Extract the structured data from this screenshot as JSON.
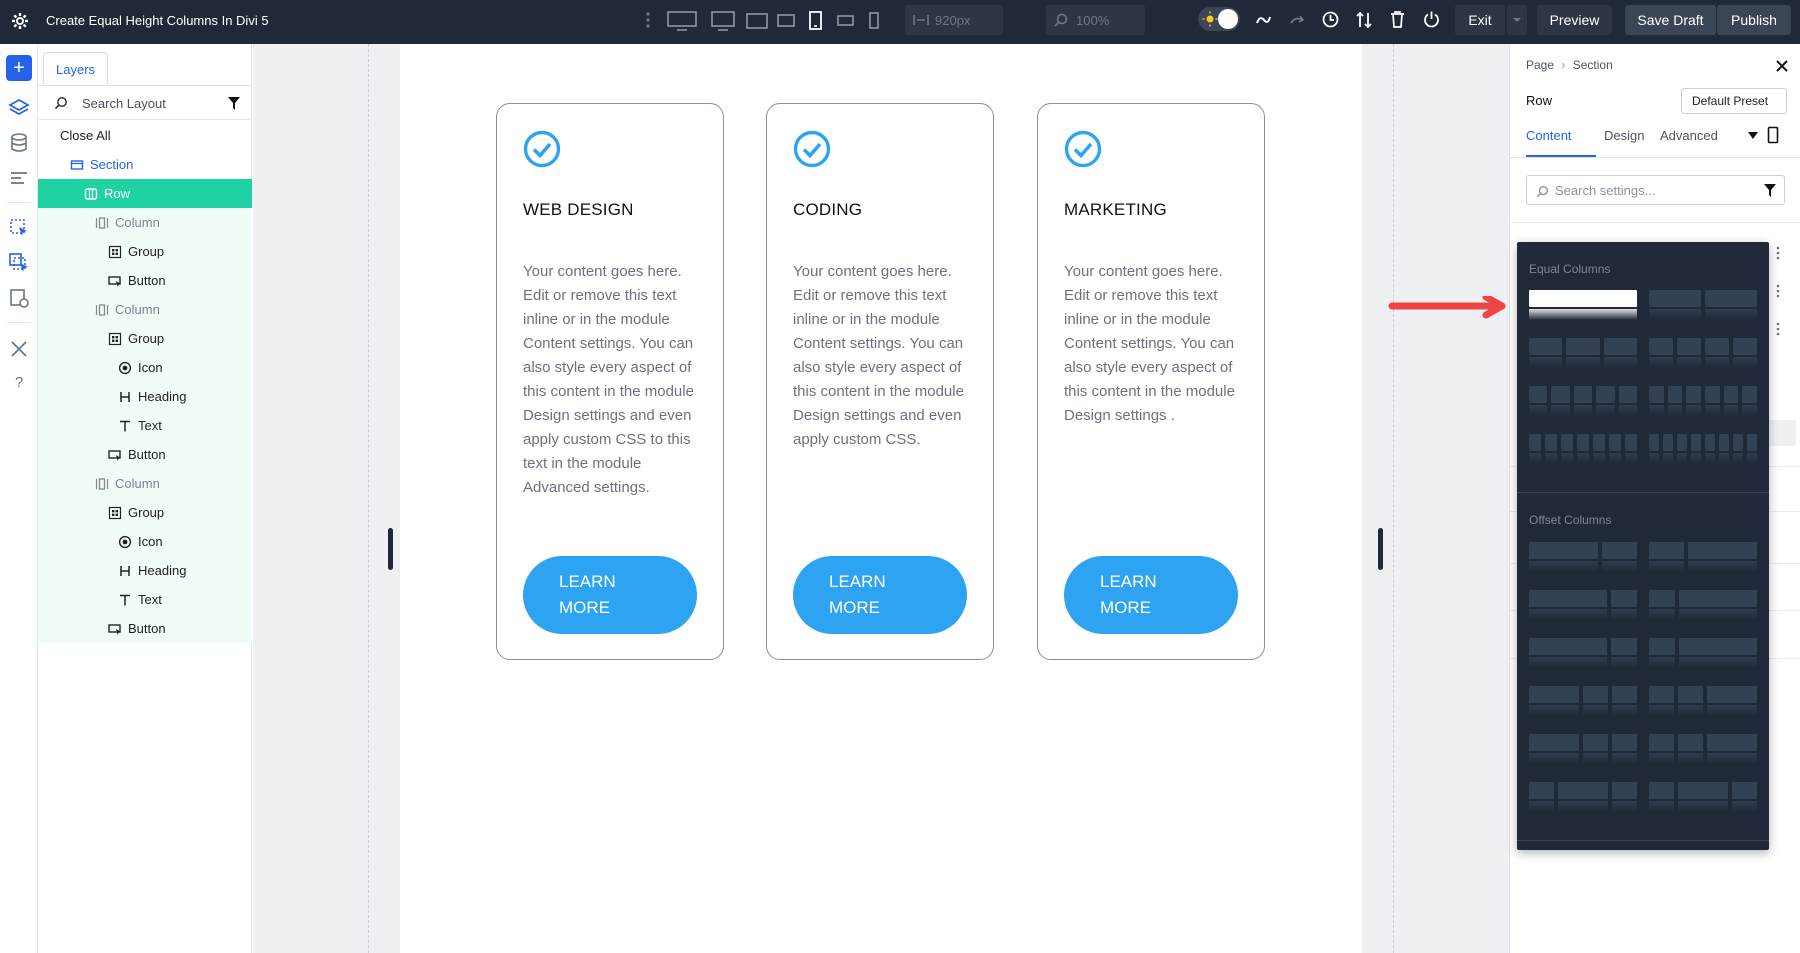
{
  "topbar": {
    "title": "Create Equal Height Columns In Divi 5",
    "width_value": "920px",
    "zoom_value": "100%",
    "exit_label": "Exit",
    "preview_label": "Preview",
    "save_draft_label": "Save Draft",
    "publish_label": "Publish"
  },
  "layers": {
    "tab_label": "Layers",
    "search_placeholder": "Search Layout",
    "close_all": "Close All",
    "items": [
      {
        "label": "Section",
        "type": "section",
        "level": 1
      },
      {
        "label": "Row",
        "type": "row",
        "level": 2
      },
      {
        "label": "Column",
        "type": "column",
        "level": 3
      },
      {
        "label": "Group",
        "type": "group",
        "level": 4
      },
      {
        "label": "Button",
        "type": "button",
        "level": 4
      },
      {
        "label": "Column",
        "type": "column",
        "level": 3
      },
      {
        "label": "Group",
        "type": "group",
        "level": 4
      },
      {
        "label": "Icon",
        "type": "icon",
        "level": 5
      },
      {
        "label": "Heading",
        "type": "heading",
        "level": 5
      },
      {
        "label": "Text",
        "type": "text",
        "level": 5
      },
      {
        "label": "Button",
        "type": "button",
        "level": 4
      },
      {
        "label": "Column",
        "type": "column",
        "level": 3
      },
      {
        "label": "Group",
        "type": "group",
        "level": 4
      },
      {
        "label": "Icon",
        "type": "icon",
        "level": 5
      },
      {
        "label": "Heading",
        "type": "heading",
        "level": 5
      },
      {
        "label": "Text",
        "type": "text",
        "level": 5
      },
      {
        "label": "Button",
        "type": "button",
        "level": 4
      }
    ]
  },
  "cards": [
    {
      "heading": "WEB DESIGN",
      "text": "Your content goes here. Edit or remove this text inline or in the module Content settings. You can also style every aspect of this content in the module Design settings and even apply custom CSS to this text in the module Advanced settings.",
      "button_line1": "LEARN",
      "button_line2": "MORE"
    },
    {
      "heading": "CODING",
      "text": "Your content goes here. Edit or remove this text inline or in the module Content settings. You can also style every aspect of this content in the module Design settings and even apply custom CSS.",
      "button_line1": "LEARN",
      "button_line2": "MORE"
    },
    {
      "heading": "MARKETING",
      "text": "Your content goes here. Edit or remove this text inline or in the module Content settings. You can also style every aspect of this content in the module Design settings .",
      "button_line1": "LEARN",
      "button_line2": "MORE"
    }
  ],
  "settings": {
    "breadcrumb_page": "Page",
    "breadcrumb_section": "Section",
    "element_label": "Row",
    "preset_label": "Default Preset",
    "tabs": [
      "Content",
      "Design",
      "Advanced"
    ],
    "active_tab": "Content",
    "search_placeholder": "Search settings..."
  },
  "structure_dropdown": {
    "equal_label": "Equal Columns",
    "offset_label": "Offset Columns"
  },
  "colors": {
    "accent": "#2563eb",
    "selected_layer": "#1ed2a2",
    "button": "#2ea3f2",
    "topbar": "#1f2937",
    "arrow": "#ef4444"
  }
}
